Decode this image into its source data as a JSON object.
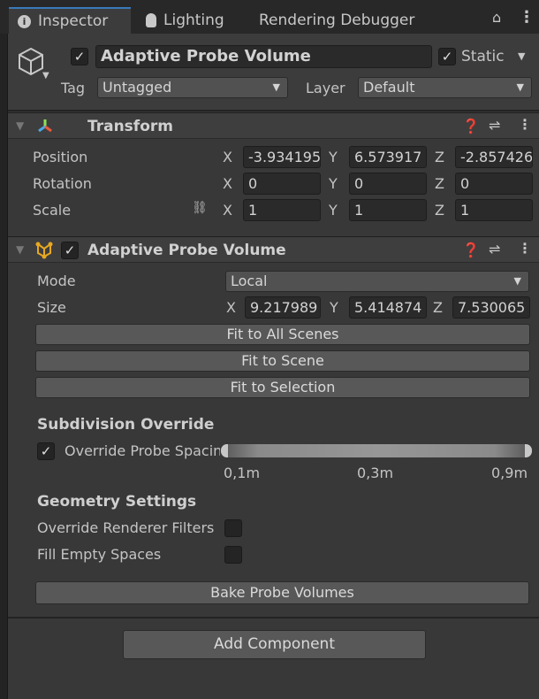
{
  "tabs": [
    {
      "label": "Inspector",
      "icon": "info-icon"
    },
    {
      "label": "Lighting",
      "icon": "bulb-icon"
    },
    {
      "label": "Rendering Debugger"
    }
  ],
  "gameobject": {
    "active": true,
    "name": "Adaptive Probe Volume",
    "static_checked": true,
    "static_label": "Static",
    "tag_label": "Tag",
    "tag_value": "Untagged",
    "layer_label": "Layer",
    "layer_value": "Default"
  },
  "transform": {
    "title": "Transform",
    "rows": [
      {
        "label": "Position",
        "x": "-3.934195",
        "y": "6.573917",
        "z": "-2.857426"
      },
      {
        "label": "Rotation",
        "x": "0",
        "y": "0",
        "z": "0"
      },
      {
        "label": "Scale",
        "x": "1",
        "y": "1",
        "z": "1"
      }
    ]
  },
  "axes": {
    "x": "X",
    "y": "Y",
    "z": "Z"
  },
  "apv": {
    "title": "Adaptive Probe Volume",
    "enabled": true,
    "mode_label": "Mode",
    "mode_value": "Local",
    "size_label": "Size",
    "size": {
      "x": "9.217989",
      "y": "5.414874",
      "z": "7.530065"
    },
    "buttons": [
      "Fit to All Scenes",
      "Fit to Scene",
      "Fit to Selection"
    ],
    "subdivision_heading": "Subdivision Override",
    "override_spacing_label": "Override Probe Spacing",
    "override_spacing_checked": true,
    "spacing_ticks": [
      "0,1m",
      "0,3m",
      "0,9m"
    ],
    "geometry_heading": "Geometry Settings",
    "override_filters_label": "Override Renderer Filters",
    "override_filters_checked": false,
    "fill_empty_label": "Fill Empty Spaces",
    "fill_empty_checked": false,
    "bake_label": "Bake Probe Volumes"
  },
  "add_component_label": "Add Component"
}
